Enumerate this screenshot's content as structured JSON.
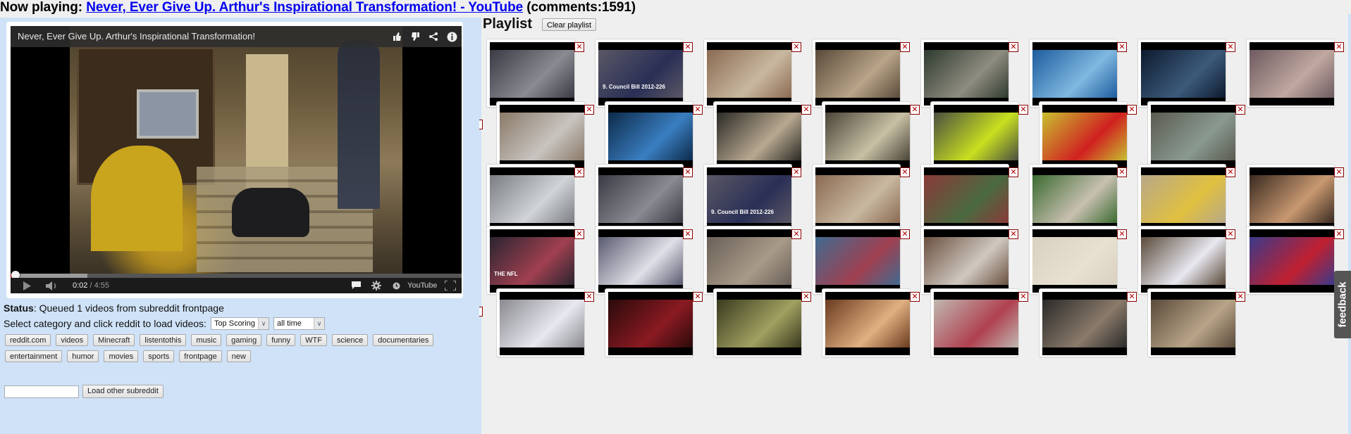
{
  "header": {
    "prefix": "Now playing:",
    "video_link": "Never, Ever Give Up. Arthur's Inspirational Transformation! - YouTube",
    "comments": "(comments:1591)"
  },
  "player": {
    "title": "Never, Ever Give Up.  Arthur's Inspirational Transformation!",
    "icons": [
      "thumbs-up-icon",
      "thumbs-down-icon",
      "share-icon",
      "info-icon"
    ],
    "current_time": "0:02",
    "duration": "4:55",
    "time_separator": "/",
    "played_fraction": 0.007,
    "loaded_fraction": 0.17,
    "controls": [
      "play-icon",
      "volume-icon",
      "captions-icon",
      "settings-icon",
      "watch-later-icon",
      "youtube-logo",
      "fullscreen-icon"
    ],
    "youtube_logo_text": "YouTube"
  },
  "status": {
    "label": "Status",
    "text": ": Queued 1 videos from subreddit frontpage"
  },
  "category": {
    "prompt": "Select category and click reddit to load videos:",
    "sort_selected": "Top Scoring",
    "time_selected": "all time"
  },
  "subreddits": {
    "row1": [
      "reddit.com",
      "videos",
      "Minecraft",
      "listentothis",
      "music",
      "gaming",
      "funny",
      "WTF",
      "science",
      "documentaries"
    ],
    "row2": [
      "entertainment",
      "humor",
      "movies",
      "sports",
      "frontpage",
      "new"
    ]
  },
  "other_subreddit": {
    "input_value": "",
    "button_label": "Load other subreddit"
  },
  "playlist": {
    "title": "Playlist",
    "clear_label": "Clear playlist",
    "remove_glyph": "✕",
    "rows": [
      {
        "offset": "none",
        "items": [
          {
            "desc": "Reporter with FOX 2 microphone",
            "colors": [
              "#3a3a44",
              "#8a8a92"
            ]
          },
          {
            "desc": "9. Council Bill 2012-226 hearing",
            "colors": [
              "#5a5866",
              "#2a2f55"
            ],
            "caption": "9. Council Bill 2012-226"
          },
          {
            "desc": "Man and boy faces",
            "colors": [
              "#8b6a52",
              "#c9b8a0"
            ]
          },
          {
            "desc": "Dry grass close-up",
            "colors": [
              "#5a4a3a",
              "#b8a488"
            ]
          },
          {
            "desc": "Helicopter cockpit view",
            "colors": [
              "#2e3a2e",
              "#8f8c80"
            ]
          },
          {
            "desc": "Ocean whirlpool from above",
            "colors": [
              "#1d5c9e",
              "#7fb8e0"
            ]
          },
          {
            "desc": "Dark stage performance",
            "colors": [
              "#0d1a2e",
              "#3c5a7a"
            ]
          },
          {
            "desc": "Humor man with chips",
            "colors": [
              "#6e5a60",
              "#c0a8a0"
            ]
          }
        ]
      },
      {
        "offset": "shifted",
        "items": [
          {
            "desc": "Man in warehouse",
            "colors": [
              "#8a7a68",
              "#c8c4c0"
            ]
          },
          {
            "desc": "Blue underwater cave",
            "colors": [
              "#0c2a4a",
              "#3a7ec0"
            ]
          },
          {
            "desc": "Man standing and handstand",
            "colors": [
              "#2a2a26",
              "#b8a890"
            ]
          },
          {
            "desc": "Man at desk",
            "colors": [
              "#4a4438",
              "#c8c0a4"
            ]
          },
          {
            "desc": "Yellow costume at convention",
            "colors": [
              "#4a4e40",
              "#c8e020"
            ]
          },
          {
            "desc": "Spider-Man cartoon",
            "colors": [
              "#c8c030",
              "#d02020"
            ]
          },
          {
            "desc": "Warehouse interior",
            "colors": [
              "#5a5a50",
              "#8a9a90"
            ]
          }
        ]
      },
      {
        "offset": "none",
        "items": [
          {
            "desc": "Person slipping on ice",
            "colors": [
              "#7a7e82",
              "#d0d4d8"
            ]
          },
          {
            "desc": "Reporter with FOX 2 microphone",
            "colors": [
              "#3a3a44",
              "#8a8a92"
            ]
          },
          {
            "desc": "9. Council Bill 2012-226 hearing",
            "colors": [
              "#5a5866",
              "#2a2f55"
            ],
            "caption": "9. Council Bill 2012-226"
          },
          {
            "desc": "Man and boy faces",
            "colors": [
              "#8b6a52",
              "#c9b8a0"
            ]
          },
          {
            "desc": "Marching band stadium",
            "colors": [
              "#8a3a3a",
              "#4a6a40"
            ]
          },
          {
            "desc": "Woman and police officer",
            "colors": [
              "#3a6a30",
              "#c8c0b0"
            ]
          },
          {
            "desc": "Man with snake",
            "colors": [
              "#b8a888",
              "#e0c040"
            ]
          },
          {
            "desc": "Person in hat with feet",
            "colors": [
              "#3a2a20",
              "#c89870"
            ]
          }
        ]
      },
      {
        "offset": "none",
        "items": [
          {
            "desc": "The NFL - A Bad Lip Reading",
            "colors": [
              "#2a2430",
              "#a04050"
            ],
            "caption": "THE NFL"
          },
          {
            "desc": "Gray haired man at table",
            "colors": [
              "#5a5a70",
              "#e0e0e8"
            ]
          },
          {
            "desc": "Bicycle crash street",
            "colors": [
              "#6a6058",
              "#a89a88"
            ]
          },
          {
            "desc": "Woman in dentist chair",
            "colors": [
              "#406a90",
              "#a04050"
            ]
          },
          {
            "desc": "Hallway with dog",
            "colors": [
              "#6a5040",
              "#d0c8c0"
            ]
          },
          {
            "desc": "Dumb ways to die characters",
            "colors": [
              "#d8d0c0",
              "#e8e0d0"
            ]
          },
          {
            "desc": "Snow and leaves",
            "colors": [
              "#5a4a3a",
              "#e8e8f0"
            ]
          },
          {
            "desc": "Talk show guest",
            "colors": [
              "#3a3a8a",
              "#c02030"
            ]
          }
        ]
      },
      {
        "offset": "shifted",
        "items": [
          {
            "desc": "White sheet backdrop",
            "colors": [
              "#8a8a90",
              "#e8e8f0"
            ]
          },
          {
            "desc": "Theatre balcony red",
            "colors": [
              "#2a0a0a",
              "#8a1a22"
            ]
          },
          {
            "desc": "Subway car interior",
            "colors": [
              "#3a3a20",
              "#a0a060"
            ]
          },
          {
            "desc": "Dog with eyes closed",
            "colors": [
              "#6a3a20",
              "#e0b080"
            ]
          },
          {
            "desc": "Person with lipstick",
            "colors": [
              "#c0b8b0",
              "#b04050"
            ]
          },
          {
            "desc": "Piano player",
            "colors": [
              "#2a2a2a",
              "#8a7a6a"
            ]
          },
          {
            "desc": "Dry grass close-up",
            "colors": [
              "#5a4a3a",
              "#b8a488"
            ]
          }
        ]
      }
    ]
  },
  "feedback": {
    "label": "feedback"
  }
}
